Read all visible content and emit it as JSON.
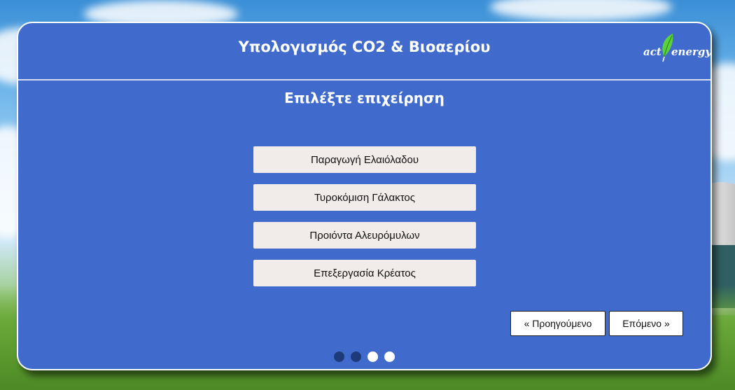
{
  "app": {
    "title": "Υπολογισμός CO2 & Βιοαερίου",
    "logo": {
      "part1": "act",
      "part2": "energy",
      "leaf_icon": "leaf-icon",
      "leaf_color": "#5bd13a"
    }
  },
  "page": {
    "heading": "Επιλέξτε επιχείρηση",
    "options": [
      "Παραγωγή Ελαιόλαδου",
      "Τυροκόμιση Γάλακτος",
      "Προιόντα Αλευρόμυλων",
      "Επεξεργασία Κρέατος"
    ]
  },
  "navigation": {
    "prev_label": "« Προηγούμενο",
    "next_label": "Επόμενο »"
  },
  "progress": {
    "steps_total": 4,
    "steps_completed": 2
  },
  "colors": {
    "panel": "#406bcd",
    "option_bg": "#f1ebea",
    "dot_active": "#1d3b79",
    "dot_inactive": "#ffffff"
  }
}
